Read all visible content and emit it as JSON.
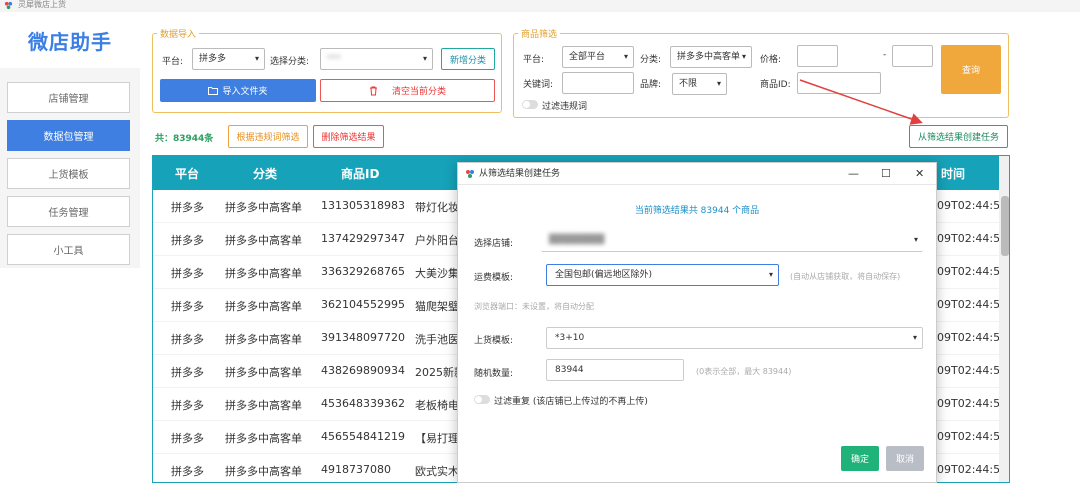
{
  "window": {
    "title": "灵犀微店上货"
  },
  "app": {
    "logo": "微店助手"
  },
  "sidebar": {
    "items": [
      {
        "label": "店铺管理"
      },
      {
        "label": "数据包管理"
      },
      {
        "label": "上货模板"
      },
      {
        "label": "任务管理"
      },
      {
        "label": "小工具"
      }
    ]
  },
  "data_import": {
    "legend": "数据导入",
    "platform_label": "平台:",
    "platform_value": "拼多多",
    "category_label": "选择分类:",
    "category_value": "***",
    "add_category": "新增分类",
    "import_folder": "导入文件夹",
    "clear_category": "清空当前分类"
  },
  "filter": {
    "legend": "商品筛选",
    "platform_label": "平台:",
    "platform_value": "全部平台",
    "category_label": "分类:",
    "category_value": "拼多多中高客单",
    "price_label": "价格:",
    "price_sep": "-",
    "query": "查询",
    "keyword_label": "关键词:",
    "brand_label": "品牌:",
    "brand_value": "不限",
    "product_id_label": "商品ID:",
    "violation_toggle": "过滤违规词"
  },
  "actions": {
    "count": "共：83944条",
    "filter_by_rules": "根据违规词筛选",
    "delete_results": "删除筛选结果",
    "create_task": "从筛选结果创建任务"
  },
  "table": {
    "headers": [
      "平台",
      "分类",
      "商品ID",
      "时间"
    ],
    "rows": [
      {
        "platform": "拼多多",
        "category": "拼多多中高客单",
        "id": "131305318983",
        "title": "带灯化妆",
        "time": "09T02:44:5"
      },
      {
        "platform": "拼多多",
        "category": "拼多多中高客单",
        "id": "137429297347",
        "title": "户外阳台",
        "time": "09T02:44:5"
      },
      {
        "platform": "拼多多",
        "category": "拼多多中高客单",
        "id": "336329268765",
        "title": "大美沙集",
        "time": "09T02:44:5"
      },
      {
        "platform": "拼多多",
        "category": "拼多多中高客单",
        "id": "362104552995",
        "title": "猫爬架璧",
        "time": "09T02:44:5"
      },
      {
        "platform": "拼多多",
        "category": "拼多多中高客单",
        "id": "391348097720",
        "title": "洗手池医",
        "time": "09T02:44:5"
      },
      {
        "platform": "拼多多",
        "category": "拼多多中高客单",
        "id": "438269890934",
        "title": "2025新款",
        "time": "09T02:44:5"
      },
      {
        "platform": "拼多多",
        "category": "拼多多中高客单",
        "id": "453648339362",
        "title": "老板椅电",
        "time": "09T02:44:5"
      },
      {
        "platform": "拼多多",
        "category": "拼多多中高客单",
        "id": "456554841219",
        "title": "【易打理",
        "time": "09T02:44:5"
      },
      {
        "platform": "拼多多",
        "category": "拼多多中高客单",
        "id": "4918737080",
        "title": "欧式实木",
        "time": "09T02:44:5"
      }
    ]
  },
  "dialog": {
    "title": "从筛选结果创建任务",
    "summary": "当前筛选结果共 83944 个商品",
    "store_label": "选择店铺:",
    "store_value": "████████",
    "shipping_label": "运费模板:",
    "shipping_value": "全国包邮(偏远地区除外)",
    "shipping_hint": "(自动从店铺获取，将自动保存)",
    "browser_note": "浏览器端口：未设置，将自动分配",
    "template_label": "上货模板:",
    "template_value": "*3+10",
    "random_label": "随机数量:",
    "random_value": "83944",
    "random_hint": "(0表示全部，最大 83944)",
    "dedupe_label": "过滤重复 (该店铺已上传过的不再上传)",
    "ok": "确定",
    "cancel": "取消"
  }
}
